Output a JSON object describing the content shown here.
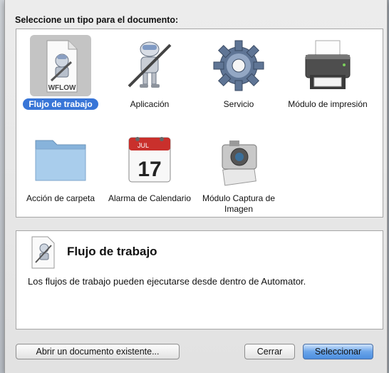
{
  "dialog": {
    "prompt": "Seleccione un tipo para el documento:",
    "types": [
      {
        "label": "Flujo de trabajo",
        "icon": "workflow-document-icon",
        "selected": true,
        "badge": "WFLOW"
      },
      {
        "label": "Aplicación",
        "icon": "automator-robot-icon",
        "selected": false
      },
      {
        "label": "Servicio",
        "icon": "gear-icon",
        "selected": false
      },
      {
        "label": "Módulo de impresión",
        "icon": "printer-icon",
        "selected": false
      },
      {
        "label": "Acción de carpeta",
        "icon": "folder-icon",
        "selected": false
      },
      {
        "label": "Alarma de Calendario",
        "icon": "calendar-icon",
        "selected": false,
        "month": "JUL",
        "day": "17"
      },
      {
        "label": "Módulo Captura de Imagen",
        "icon": "camera-icon",
        "selected": false
      }
    ],
    "description": {
      "title": "Flujo de trabajo",
      "text": "Los flujos de trabajo pueden ejecutarse desde dentro de Automator."
    },
    "buttons": {
      "open_existing": "Abrir un documento existente...",
      "close": "Cerrar",
      "select": "Seleccionar"
    },
    "colors": {
      "selection_blue": "#3875d7",
      "default_button": "#6aa5ea"
    }
  }
}
